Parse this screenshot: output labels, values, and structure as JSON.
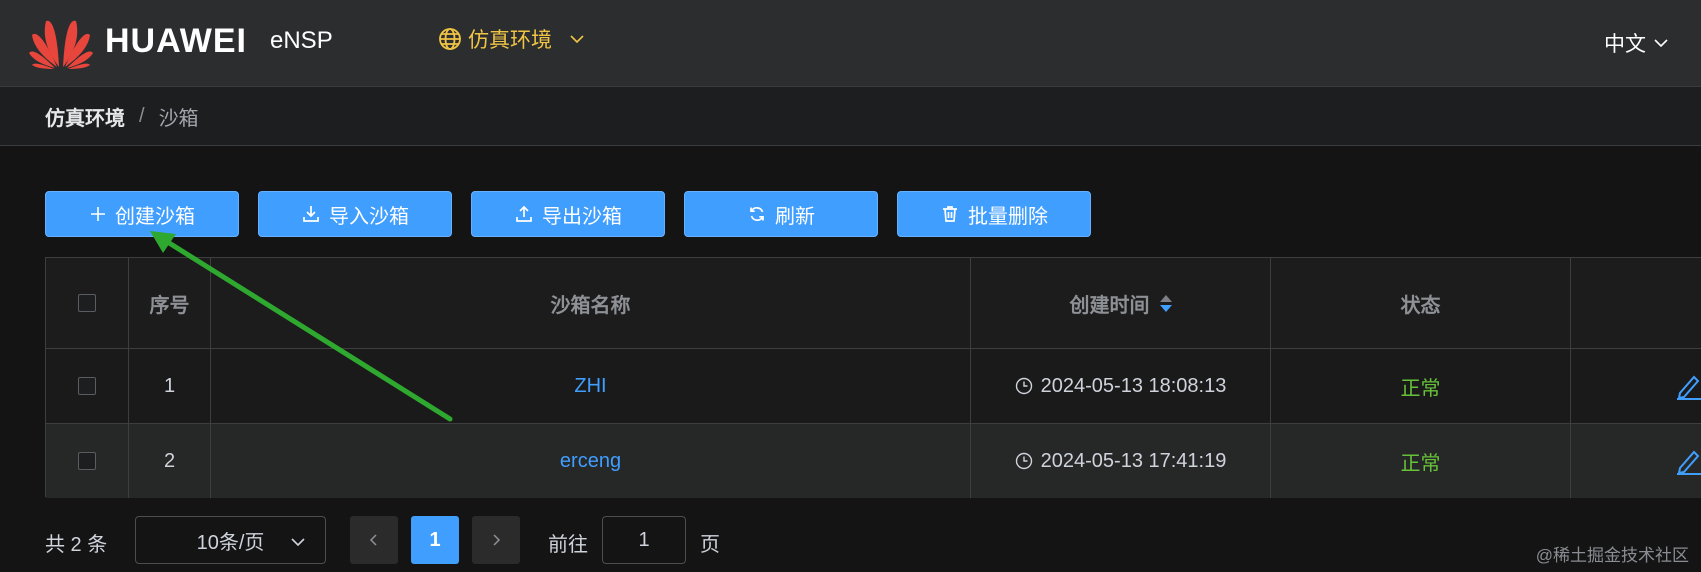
{
  "header": {
    "brand": "HUAWEI",
    "product": "eNSP",
    "env_selector": "仿真环境",
    "language": "中文"
  },
  "breadcrumb": {
    "items": [
      "仿真环境",
      "沙箱"
    ],
    "separator": "/"
  },
  "toolbar": {
    "create_label": "创建沙箱",
    "import_label": "导入沙箱",
    "export_label": "导出沙箱",
    "refresh_label": "刷新",
    "batch_delete_label": "批量删除"
  },
  "table": {
    "columns": [
      "序号",
      "沙箱名称",
      "创建时间",
      "状态"
    ],
    "rows": [
      {
        "index": "1",
        "name": "ZHI",
        "created": "2024-05-13 18:08:13",
        "status": "正常"
      },
      {
        "index": "2",
        "name": "erceng",
        "created": "2024-05-13 17:41:19",
        "status": "正常"
      }
    ]
  },
  "pagination": {
    "total_text": "共 2 条",
    "page_size": "10条/页",
    "current_page": "1",
    "goto_prefix": "前往",
    "goto_value": "1",
    "goto_suffix": "页"
  },
  "watermark": "@稀土掘金技术社区",
  "colors": {
    "accent": "#409eff",
    "env_yellow": "#f0c445",
    "status_ok": "#67c23a",
    "annotation_arrow": "#2ea82e",
    "huawei_red": "#e8453c"
  }
}
